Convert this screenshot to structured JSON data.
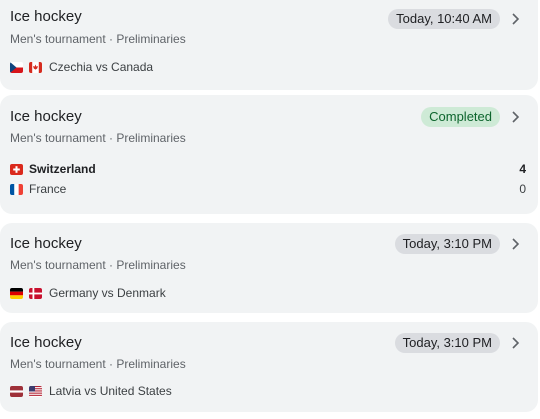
{
  "games": [
    {
      "sport": "Ice hockey",
      "subtitle": "Men's tournament · Preliminaries",
      "status": "Today, 10:40 AM",
      "matchup": "Czechia vs Canada",
      "flags": [
        "czechia-flag-icon",
        "canada-flag-icon"
      ]
    },
    {
      "sport": "Ice hockey",
      "subtitle": "Men's tournament · Preliminaries",
      "status": "Completed",
      "teams": [
        {
          "name": "Switzerland",
          "score": "4",
          "flag": "switzerland-flag-icon"
        },
        {
          "name": "France",
          "score": "0",
          "flag": "france-flag-icon"
        }
      ],
      "status_color": "#ceead6"
    },
    {
      "sport": "Ice hockey",
      "subtitle": "Men's tournament · Preliminaries",
      "status": "Today, 3:10 PM",
      "matchup": "Germany vs Denmark",
      "flags": [
        "germany-flag-icon",
        "denmark-flag-icon"
      ]
    },
    {
      "sport": "Ice hockey",
      "subtitle": "Men's tournament · Preliminaries",
      "status": "Today, 3:10 PM",
      "matchup": "Latvia vs United States",
      "flags": [
        "latvia-flag-icon",
        "usa-flag-icon"
      ]
    }
  ],
  "icons": {
    "chevron": "chevron-right-icon"
  },
  "colors": {
    "card_bg": "#f1f3f4",
    "pill_bg": "#dadce0",
    "completed_bg": "#ceead6",
    "completed_text": "#0d652d"
  }
}
